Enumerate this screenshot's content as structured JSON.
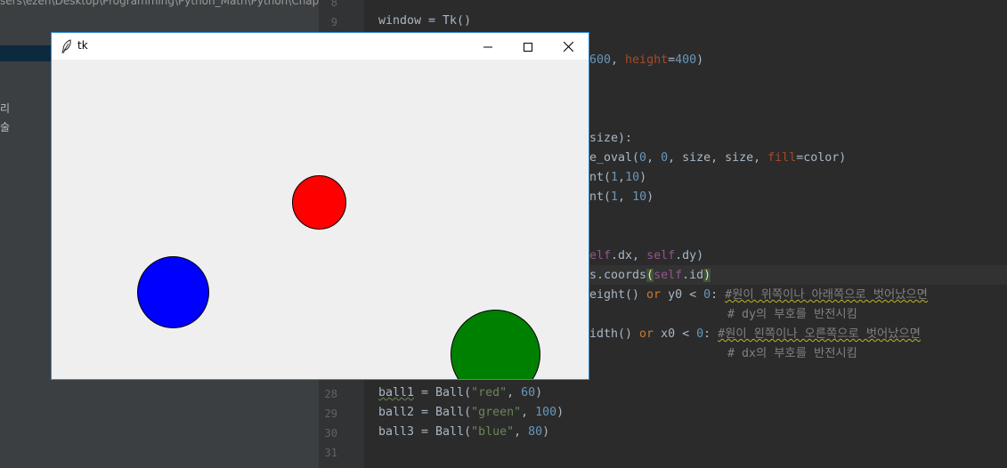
{
  "sidebar": {
    "path_prefix": "sers\\ezen\\Desktop\\Programming\\Python_Math\\Python\\Chap",
    "items": [
      {
        "label": "리"
      },
      {
        "label": "술"
      }
    ]
  },
  "editor": {
    "line_numbers": {
      "l8": "8",
      "l9": "9",
      "l28": "28",
      "l29": "29",
      "l30": "30",
      "l31": "31"
    },
    "lines": {
      "window": "window = Tk()",
      "canvas_args": {
        "a": "600",
        "b": ", ",
        "c": "height",
        "d": "=",
        "e": "400",
        "f": ")"
      },
      "size_sig": "size):",
      "oval": {
        "a": "e_oval(",
        "b": "0",
        "c": ", ",
        "d": "0",
        "e": ", size, size, ",
        "f": "fill",
        "g": "=color)"
      },
      "randint1": {
        "a": "nt(",
        "b": "1",
        "c": ",",
        "d": "10",
        "e": ")"
      },
      "randint2": {
        "a": "nt(",
        "b": "1",
        "c": ", ",
        "d": "10",
        "e": ")"
      },
      "move": {
        "a": "elf",
        "b": ".dx, ",
        "c": "self",
        "d": ".dy)"
      },
      "coords": {
        "a": "s.coords",
        "b": "(",
        "c": "self",
        "d": ".id",
        "e": ")"
      },
      "height_check": {
        "a": "eight() ",
        "b": "or",
        "c": " y0 < ",
        "d": "0",
        "e": ": ",
        "f": "#원이 위쪽이나 아래쪽으로 벗어났으면"
      },
      "dy_comment": "# dy의 부호를 반전시킴",
      "width_check": {
        "a": "idth() ",
        "b": "or",
        "c": " x0 < ",
        "d": "0",
        "e": ": ",
        "f": "#원이 왼쪽이나 오른쪽으로 벗어났으면"
      },
      "dx_comment": "# dx의 부호를 반전시킴",
      "ball1": {
        "a": "ball1",
        "b": " = Ball(",
        "c": "\"red\"",
        "d": ", ",
        "e": "60",
        "f": ")"
      },
      "ball2": {
        "a": "ball2",
        "b": " = Ball(",
        "c": "\"green\"",
        "d": ", ",
        "e": "100",
        "f": ")"
      },
      "ball3": {
        "a": "ball3",
        "b": " = Ball(",
        "c": "\"blue\"",
        "d": ", ",
        "e": "80",
        "f": ")"
      }
    }
  },
  "tk_window": {
    "title": "tk",
    "icons": {
      "app": "feather-icon",
      "minimize": "minimize-icon",
      "maximize": "maximize-icon",
      "close": "close-icon"
    },
    "balls": [
      {
        "color": "red"
      },
      {
        "color": "blue"
      },
      {
        "color": "green"
      }
    ]
  }
}
